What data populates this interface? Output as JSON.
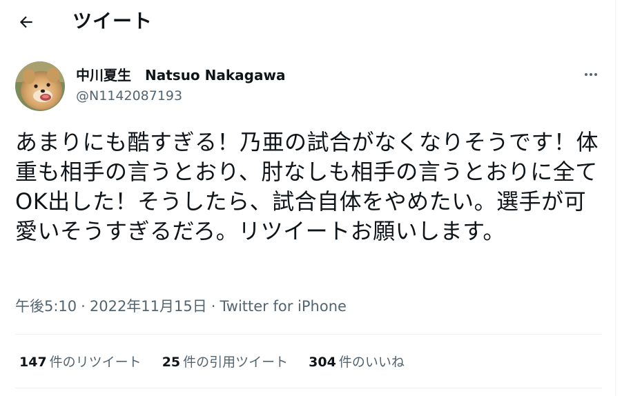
{
  "header": {
    "title": "ツイート"
  },
  "author": {
    "display_name": "中川夏生　Natsuo Nakagawa",
    "handle": "@N1142087193"
  },
  "tweet": {
    "text": "あまりにも酷すぎる！乃亜の試合がなくなりそうです！体重も相手の言うとおり、肘なしも相手の言うとおりに全てOK出した！そうしたら、試合自体をやめたい。選手が可愛いそうすぎるだろ。リツイートお願いします。",
    "time": "午後5:10",
    "date": "2022年11月15日",
    "separator": "·",
    "source": "Twitter for iPhone"
  },
  "stats": [
    {
      "count": "147",
      "label": "件のリツイート"
    },
    {
      "count": "25",
      "label": "件の引用ツイート"
    },
    {
      "count": "304",
      "label": "件のいいね"
    }
  ],
  "icons": {
    "back": "arrow-left-icon",
    "more": "more-horizontal-icon"
  },
  "colors": {
    "text_primary": "#0f1419",
    "text_secondary": "#536471",
    "divider": "#eff3f4"
  }
}
